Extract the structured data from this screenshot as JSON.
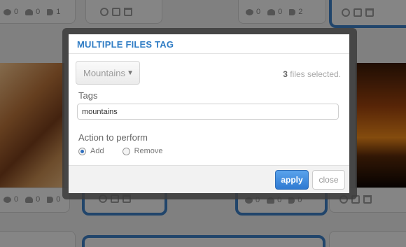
{
  "gallery": {
    "cards": [
      {
        "views": "0",
        "likes": "0",
        "tags": "1"
      },
      {
        "views": "0",
        "likes": "0",
        "tags": "2"
      },
      {
        "views": "0",
        "likes": "0",
        "tags": "0"
      },
      {
        "views": "0",
        "likes": "0",
        "tags": "0"
      }
    ]
  },
  "modal": {
    "title": "MULTIPLE FILES TAG",
    "album_selected": "Mountains",
    "files_count": "3",
    "files_suffix": "files selected.",
    "tags_label": "Tags",
    "tags_value": "mountains",
    "action_label": "Action to perform",
    "actions": [
      {
        "label": "Add",
        "selected": true
      },
      {
        "label": "Remove",
        "selected": false
      }
    ],
    "apply_label": "apply",
    "close_label": "close"
  },
  "colors": {
    "accent": "#2f7cc4",
    "apply_button": "#3a86d8"
  }
}
